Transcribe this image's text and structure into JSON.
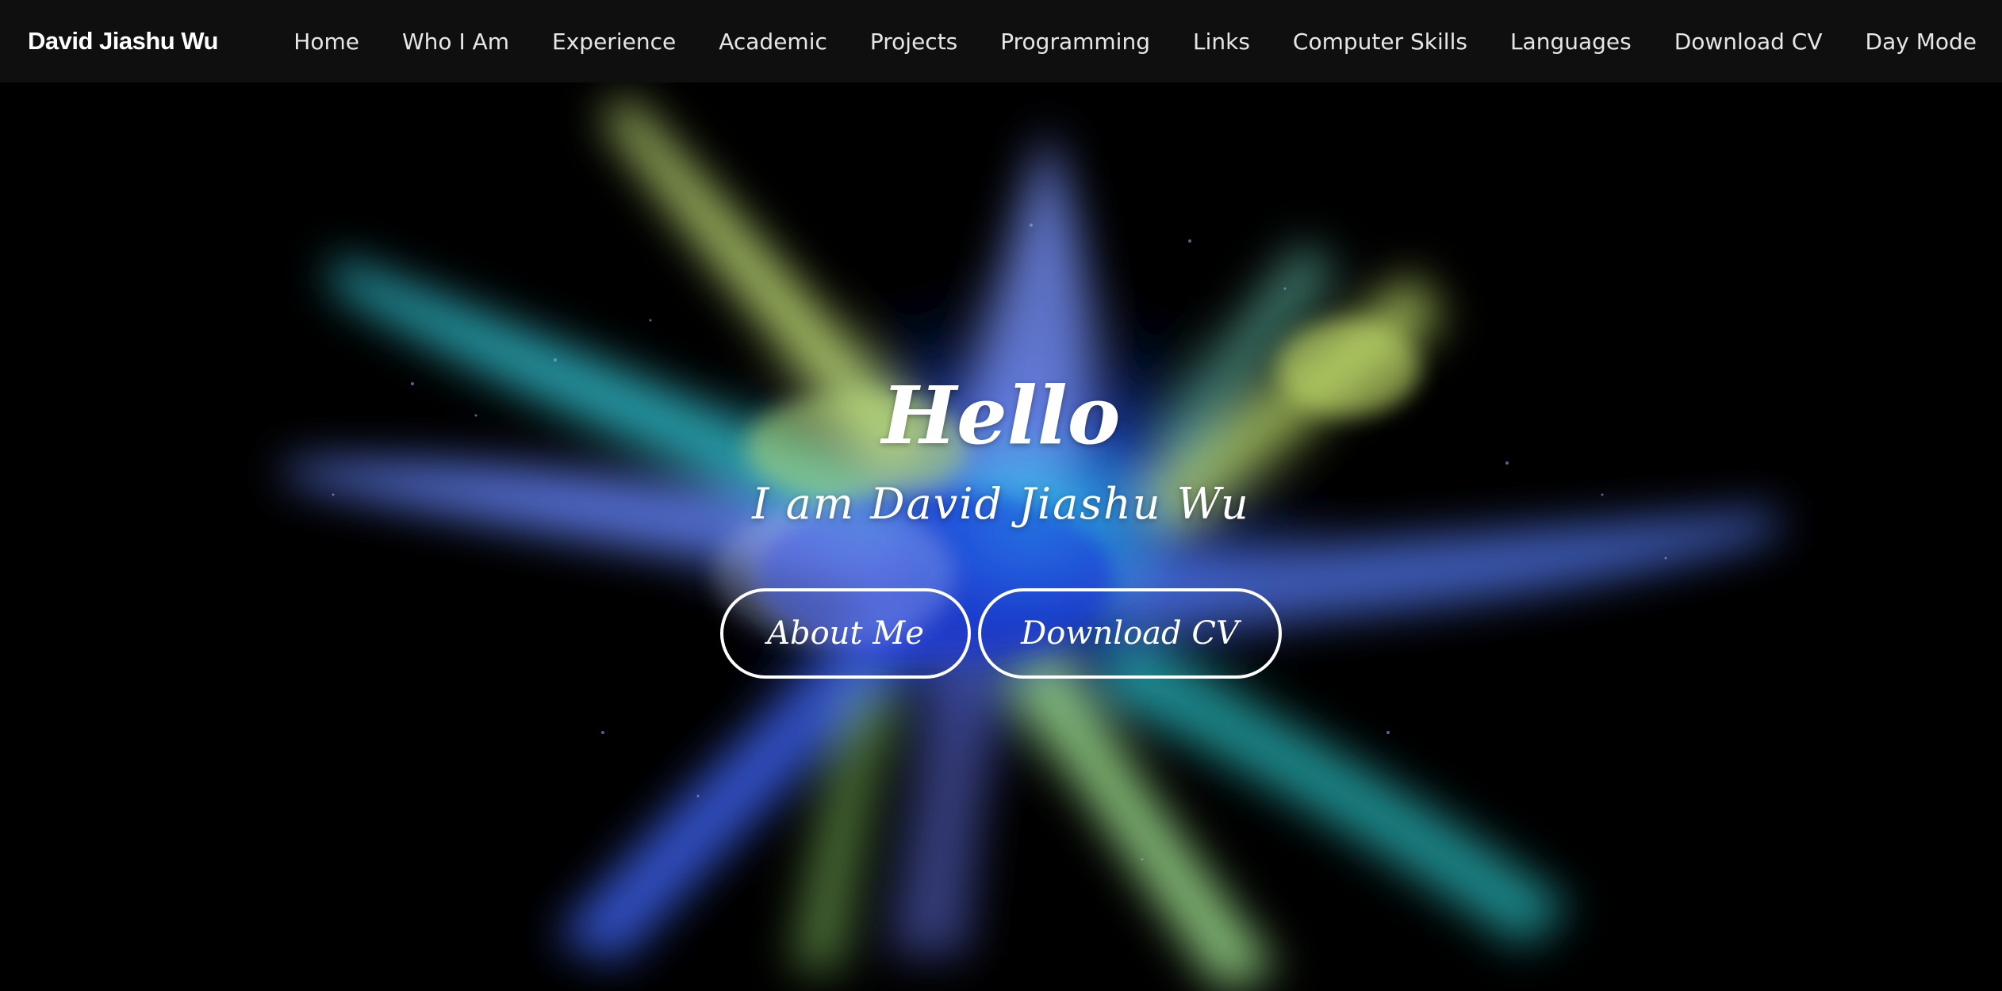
{
  "brand": {
    "name": "David Jiashu Wu"
  },
  "nav": {
    "items": [
      {
        "label": "Home"
      },
      {
        "label": "Who I Am"
      },
      {
        "label": "Experience"
      },
      {
        "label": "Academic"
      },
      {
        "label": "Projects"
      },
      {
        "label": "Programming"
      },
      {
        "label": "Links"
      },
      {
        "label": "Computer Skills"
      },
      {
        "label": "Languages"
      },
      {
        "label": "Download CV"
      },
      {
        "label": "Day Mode"
      }
    ]
  },
  "hero": {
    "greeting": "Hello",
    "subtitle": "I am David Jiashu Wu",
    "buttons": {
      "about_label": "About Me",
      "cv_label": "Download CV"
    },
    "background_image": "colorful-powder-explosion"
  },
  "colors": {
    "navbar_bg": "#0f0f0f",
    "page_bg": "#000000",
    "text": "#ffffff"
  }
}
